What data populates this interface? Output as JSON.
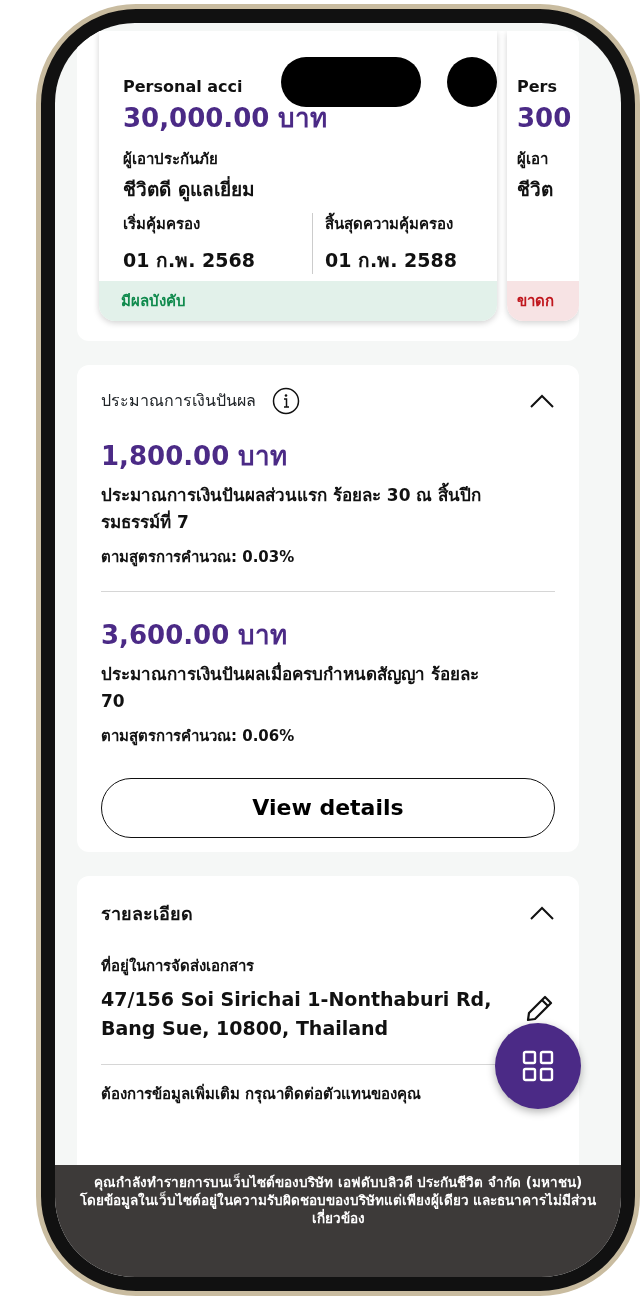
{
  "policies": [
    {
      "title": "Personal acci",
      "amount": "30,000.00 บาท",
      "insured_label": "ผู้เอาประกันภัย",
      "insured_name": "ชีวิตดี ดูแลเยี่ยม",
      "start_label": "เริ่มคุ้มครอง",
      "start_date": "01 ก.พ. 2568",
      "end_label": "สิ้นสุดความคุ้มครอง",
      "end_date": "01 ก.พ. 2588",
      "color": "#0f8a4d",
      "status_text": "มีผลบังคับ"
    },
    {
      "title": "Pers",
      "amount": "300",
      "insured_label": "ผู้เอา",
      "insured_name": "ชีวิต",
      "color": "#c0161d",
      "status_text": "ขาดก"
    }
  ],
  "dividend": {
    "title": "ประมาณการเงินปันผล",
    "expanded": true,
    "items": [
      {
        "amount": "1,800.00 บาท",
        "description": "ประมาณการเงินปันผลส่วนแรก ร้อยละ 30 ณ สิ้นปีกรมธรรม์ที่ 7",
        "formula": "ตามสูตรการคำนวณ: 0.03%"
      },
      {
        "amount": "3,600.00 บาท",
        "description": "ประมาณการเงินปันผลเมื่อครบกำหนดสัญญา ร้อยละ 70",
        "formula": "ตามสูตรการคำนวณ: 0.06%"
      }
    ],
    "button": "View details"
  },
  "details": {
    "title": "รายละเอียด",
    "expanded": true,
    "address_label": "ที่อยู่ในการจัดส่งเอกสาร",
    "address": "47/156 Soi Sirichai 1-Nonthaburi Rd, Bang Sue, 10800, Thailand",
    "note": "ต้องการข้อมูลเพิ่มเติม กรุณาติดต่อตัวแทนของคุณ"
  },
  "disclaimer": [
    "คุณกำลังทำรายการบนเว็บไซต์ของบริษัท เอฟดับบลิวดี ประกันชีวิต จำกัด (มหาชน)",
    "โดยข้อมูลในเว็บไซต์อยู่ในความรับผิดชอบของบริษัทแต่เพียงผู้เดียว และธนาคารไม่มีส่วนเกี่ยวข้อง"
  ]
}
